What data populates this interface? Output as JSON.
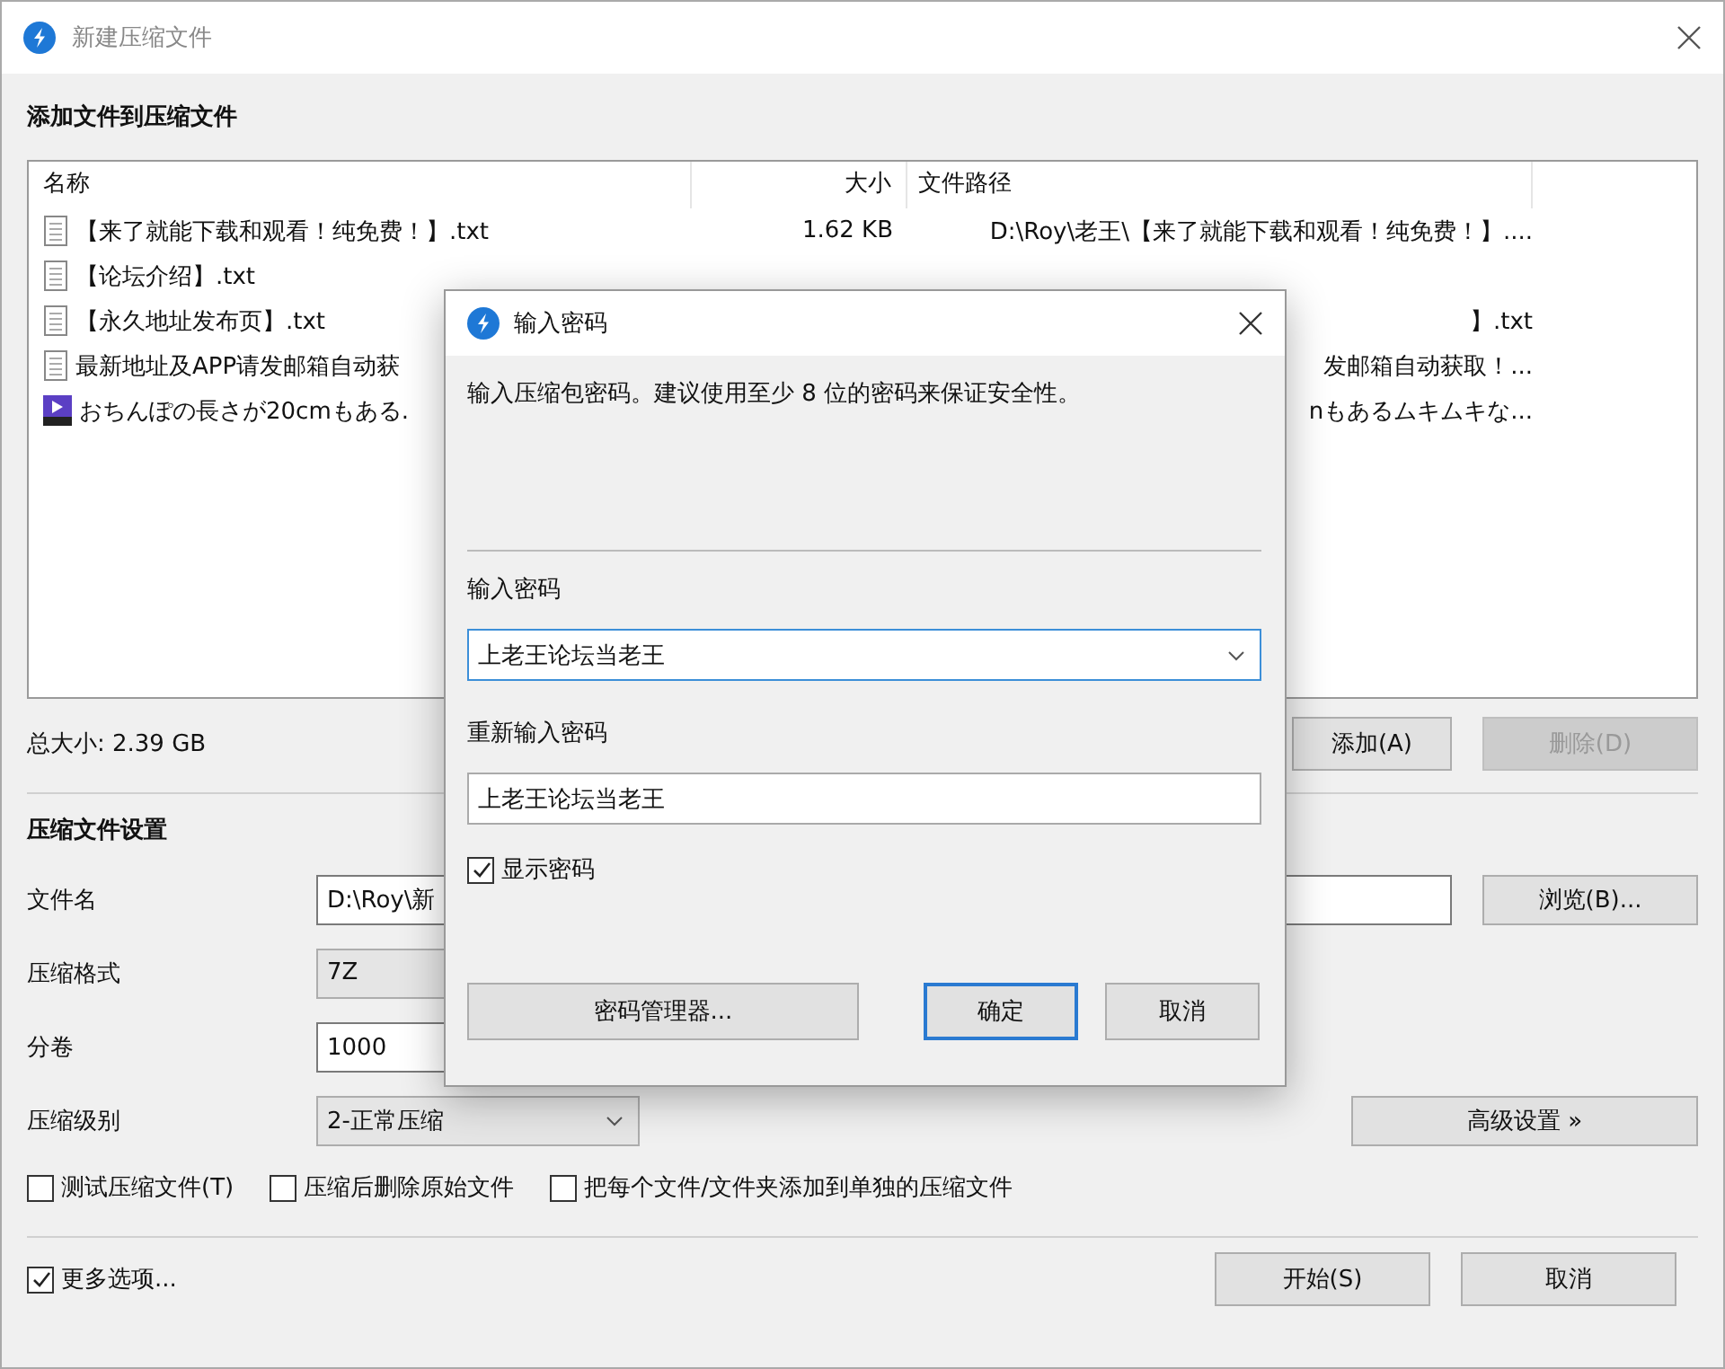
{
  "window": {
    "title": "新建压缩文件"
  },
  "files_section": {
    "heading": "添加文件到压缩文件",
    "columns": [
      "名称",
      "大小",
      "文件路径"
    ],
    "rows": [
      {
        "kind": "text",
        "name": "【来了就能下载和观看！纯免费！】.txt",
        "size": "1.62 KB",
        "path": "D:\\Roy\\老王\\【来了就能下载和观看！纯免费！】...."
      },
      {
        "kind": "text",
        "name": "【论坛介绍】.txt"
      },
      {
        "kind": "text",
        "name": "【永久地址发布页】.txt",
        "path": "】.txt"
      },
      {
        "kind": "text",
        "name": "最新地址及APP请发邮箱自动获",
        "path": "发邮箱自动获取！..."
      },
      {
        "kind": "video",
        "name": "おちんぽの長さが20cmもある.",
        "path": "nもあるムキムキな..."
      }
    ],
    "total_size": "总大小: 2.39 GB",
    "buttons": [
      {
        "label": "添加(A)",
        "disabled": false
      },
      {
        "label": "删除(D)",
        "disabled": true
      }
    ]
  },
  "settings": {
    "heading": "压缩文件设置",
    "fields": [
      {
        "kind": "text",
        "label": "文件名",
        "value": "D:\\Roy\\新"
      },
      {
        "kind": "select",
        "label": "压缩格式",
        "value": "7Z"
      },
      {
        "kind": "number",
        "label": "分卷",
        "value": "1000"
      },
      {
        "kind": "select",
        "label": "压缩级别",
        "value": "2-正常压缩"
      }
    ],
    "browse_button": "浏览(B)...",
    "advanced_button": "高级设置 »",
    "options": [
      {
        "label": "测试压缩文件(T)",
        "checked": false
      },
      {
        "label": "压缩后删除原始文件",
        "checked": false
      },
      {
        "label": "把每个文件/文件夹添加到单独的压缩文件",
        "checked": false
      }
    ]
  },
  "footer": {
    "more_options": {
      "label": "更多选项...",
      "checked": true
    },
    "buttons": [
      {
        "label": "开始(S)"
      },
      {
        "label": "取消"
      }
    ]
  },
  "dialog": {
    "title": "输入密码",
    "message": "输入压缩包密码。建议使用至少 8 位的密码来保证安全性。",
    "password_label": "输入密码",
    "password": "上老王论坛当老王",
    "confirm_label": "重新输入密码",
    "confirm": "上老王论坛当老王",
    "show_password": {
      "label": "显示密码",
      "checked": true
    },
    "buttons": [
      {
        "label": "密码管理器...",
        "default": false
      },
      {
        "label": "确定",
        "default": true
      },
      {
        "label": "取消",
        "default": false
      }
    ]
  }
}
